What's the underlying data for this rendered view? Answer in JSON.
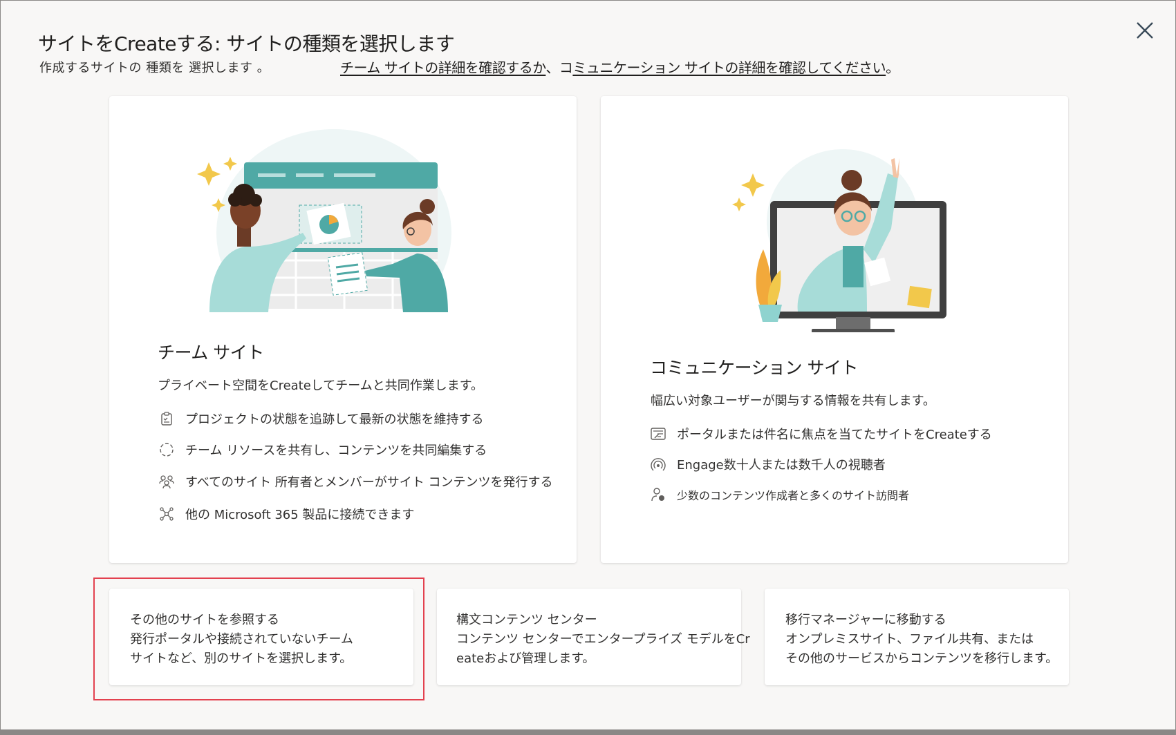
{
  "dialog": {
    "title": "サイトをCreateする: サイトの種類を選択します",
    "subtitle": "作成するサイトの 種類を 選択します 。",
    "link_team": "チーム サイトの詳細を確認するか",
    "link_separator": "、コ",
    "link_comm": "ミュニケーション サイトの詳細を確認してください",
    "link_end": "。",
    "close_icon": "close-icon"
  },
  "team_site": {
    "title": "チーム サイト",
    "description": "プライベート空間をCreateしてチームと共同作業します。",
    "features": [
      {
        "icon": "checklist-icon",
        "text": "プロジェクトの状態を追跡して最新の状態を維持する"
      },
      {
        "icon": "sync-icon",
        "text": "チーム リソースを共有し、コンテンツを共同編集する"
      },
      {
        "icon": "people-icon",
        "text": "すべてのサイト 所有者とメンバーがサイト コンテンツを発行する"
      },
      {
        "icon": "connector-icon",
        "text": "他の Microsoft 365 製品に接続できます"
      }
    ]
  },
  "comm_site": {
    "title": "コミュニケーション サイト",
    "description": "幅広い対象ユーザーが関与する情報を共有します。",
    "features": [
      {
        "icon": "news-icon",
        "text": "ポータルまたは件名に焦点を当てたサイトをCreateする"
      },
      {
        "icon": "broadcast-icon",
        "text": "Engage数十人または数千人の視聴者"
      },
      {
        "icon": "person-edit-icon",
        "text": "少数のコンテンツ作成者と多くのサイト訪問者"
      }
    ]
  },
  "options": [
    {
      "lines": [
        "その他のサイトを参照する",
        "発行ポータルや接続されていないチーム",
        "サイトなど、別のサイトを選択します。"
      ]
    },
    {
      "lines": [
        "構文コンテンツ センター",
        "コンテンツ センターでエンタープライズ モデルをCr",
        "eateおよび管理します。"
      ]
    },
    {
      "lines": [
        "移行マネージャーに移動する",
        "オンプレミスサイト、ファイル共有、または",
        "その他のサービスからコンテンツを移行します。"
      ]
    }
  ],
  "colors": {
    "teal": "#4fa9a5",
    "highlight": "#e3414f"
  }
}
